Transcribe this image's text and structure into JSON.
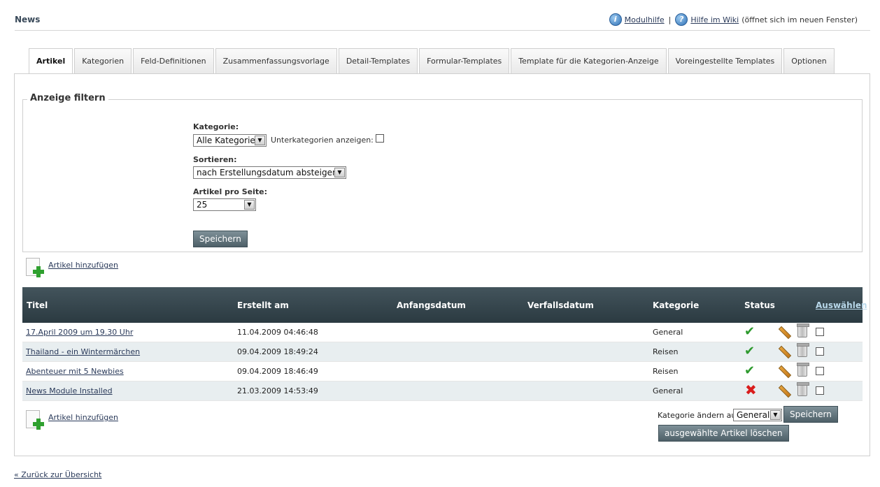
{
  "header": {
    "title": "News",
    "module_help": "Modulhilfe",
    "separator": "|",
    "wiki_help": "Hilfe im Wiki",
    "wiki_note": "(öffnet sich im neuen Fenster)"
  },
  "tabs": [
    {
      "label": "Artikel",
      "active": true
    },
    {
      "label": "Kategorien"
    },
    {
      "label": "Feld-Definitionen"
    },
    {
      "label": "Zusammenfassungsvorlage"
    },
    {
      "label": "Detail-Templates"
    },
    {
      "label": "Formular-Templates"
    },
    {
      "label": "Template für die Kategorien-Anzeige"
    },
    {
      "label": "Voreingestellte Templates"
    },
    {
      "label": "Optionen"
    }
  ],
  "filter": {
    "legend": "Anzeige filtern",
    "category_label": "Kategorie:",
    "category_value": "Alle Kategorien",
    "subcategories_label": "Unterkategorien anzeigen:",
    "sort_label": "Sortieren:",
    "sort_value": "nach Erstellungsdatum absteigend",
    "per_page_label": "Artikel pro Seite:",
    "per_page_value": "25",
    "save_label": "Speichern"
  },
  "add_article": "Artikel hinzufügen",
  "table": {
    "headers": {
      "title": "Titel",
      "created": "Erstellt am",
      "start": "Anfangsdatum",
      "expiry": "Verfallsdatum",
      "category": "Kategorie",
      "status": "Status",
      "select": "Auswählen"
    },
    "rows": [
      {
        "title": "17.April 2009 um 19.30 Uhr",
        "created": "11.04.2009 04:46:48",
        "category": "General",
        "status": "active"
      },
      {
        "title": "Thailand - ein Wintermärchen",
        "created": "09.04.2009 18:49:24",
        "category": "Reisen",
        "status": "active"
      },
      {
        "title": "Abenteuer mit 5 Newbies",
        "created": "09.04.2009 18:46:49",
        "category": "Reisen",
        "status": "active"
      },
      {
        "title": "News Module Installed",
        "created": "21.03.2009 14:53:49",
        "category": "General",
        "status": "inactive"
      }
    ]
  },
  "bulk": {
    "change_category_label": "Kategorie ändern auf:",
    "category_value": "General",
    "save_label": "Speichern",
    "delete_label": "ausgewählte Artikel löschen"
  },
  "back_link": "« Zurück zur Übersicht",
  "colors": {
    "header_bar": "#2b3a41",
    "button": "#5e7078",
    "status_ok": "#2e9a2e",
    "status_off": "#d91c1c"
  }
}
